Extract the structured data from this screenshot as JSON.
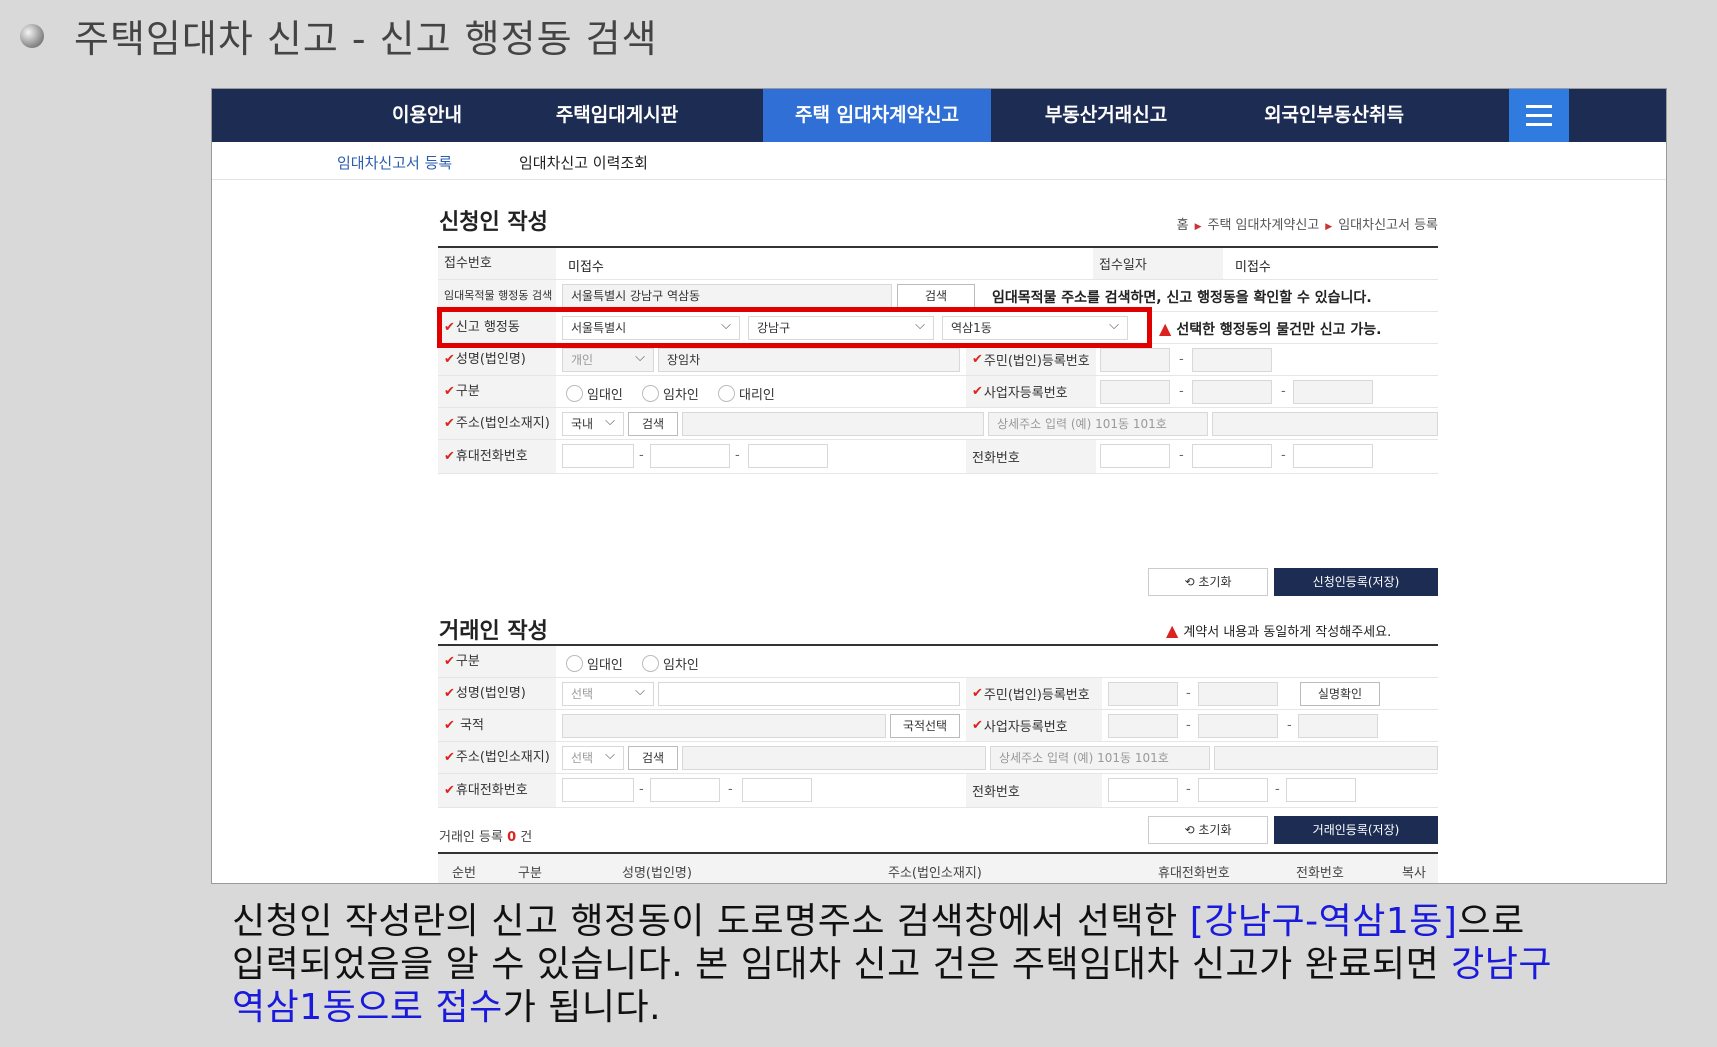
{
  "slide": {
    "title": "주택임대차 신고 - 신고 행정동 검색"
  },
  "topnav": {
    "items": [
      "이용안내",
      "주택임대게시판",
      "주택 임대차계약신고",
      "부동산거래신고",
      "외국인부동산취득"
    ],
    "active_index": 2
  },
  "subnav": {
    "items": [
      "임대차신고서 등록",
      "임대차신고 이력조회"
    ],
    "active_index": 0
  },
  "applicant": {
    "title": "신청인 작성",
    "breadcrumb": [
      "홈",
      "주택 임대차계약신고",
      "임대차신고서 등록"
    ],
    "receipt_no_label": "접수번호",
    "receipt_no_value": "미접수",
    "receipt_date_label": "접수일자",
    "receipt_date_value": "미접수",
    "property_label": "임대목적물 행정동 검색",
    "property_value": "서울특별시 강남구 역삼동",
    "property_search_btn": "검색",
    "property_note": "임대목적물 주소를 검색하면, 신고 행정동을 확인할 수 있습니다.",
    "dong_label": "신고 행정동",
    "dong_sido": "서울특별시",
    "dong_sigungu": "강남구",
    "dong_dong": "역삼1동",
    "dong_note": "선택한 행정동의 물건만 신고 가능.",
    "name_label": "성명(법인명)",
    "name_type": "개인",
    "name_value": "장임차",
    "rrn_label": "주민(법인)등록번호",
    "type_label": "구분",
    "type_options": [
      "임대인",
      "임차인",
      "대리인"
    ],
    "biz_label": "사업자등록번호",
    "addr_label": "주소(법인소재지)",
    "addr_country": "국내",
    "addr_search_btn": "검색",
    "addr_detail_placeholder": "상세주소 입력 (예) 101동 101호",
    "mobile_label": "휴대전화번호",
    "phone_label": "전화번호",
    "reset_btn": "초기화",
    "save_btn": "신청인등록(저장)"
  },
  "trader": {
    "title": "거래인 작성",
    "notice": "계약서 내용과 동일하게 작성해주세요.",
    "type_label": "구분",
    "type_options": [
      "임대인",
      "임차인"
    ],
    "name_label": "성명(법인명)",
    "name_type": "선택",
    "rrn_label": "주민(법인)등록번호",
    "verify_btn": "실명확인",
    "nation_label": "국적",
    "nation_btn": "국적선택",
    "biz_label": "사업자등록번호",
    "addr_label": "주소(법인소재지)",
    "addr_country": "선택",
    "addr_search_btn": "검색",
    "addr_detail_placeholder": "상세주소 입력 (예) 101동 101호",
    "mobile_label": "휴대전화번호",
    "phone_label": "전화번호",
    "reset_btn": "초기화",
    "save_btn": "거래인등록(저장)",
    "count_prefix": "거래인 등록",
    "count_value": "0",
    "count_suffix": "건",
    "table_headers": [
      "순번",
      "구분",
      "성명(법인명)",
      "주소(법인소재지)",
      "휴대전화번호",
      "전화번호",
      "복사"
    ]
  },
  "caption": {
    "line1_a": "신청인 작성란의 신고 행정동이 도로명주소 검색창에서 선택한 ",
    "line1_hl": "[강남구-역삼1동]",
    "line1_b": "으로",
    "line2_a": "입력되었음을 알 수 있습니다. 본 임대차 신고 건은 주택임대차 신고가 완료되면 ",
    "line2_hl": "강남구",
    "line3_hl": "역삼1동으로 접수",
    "line3_b": "가 됩니다."
  }
}
